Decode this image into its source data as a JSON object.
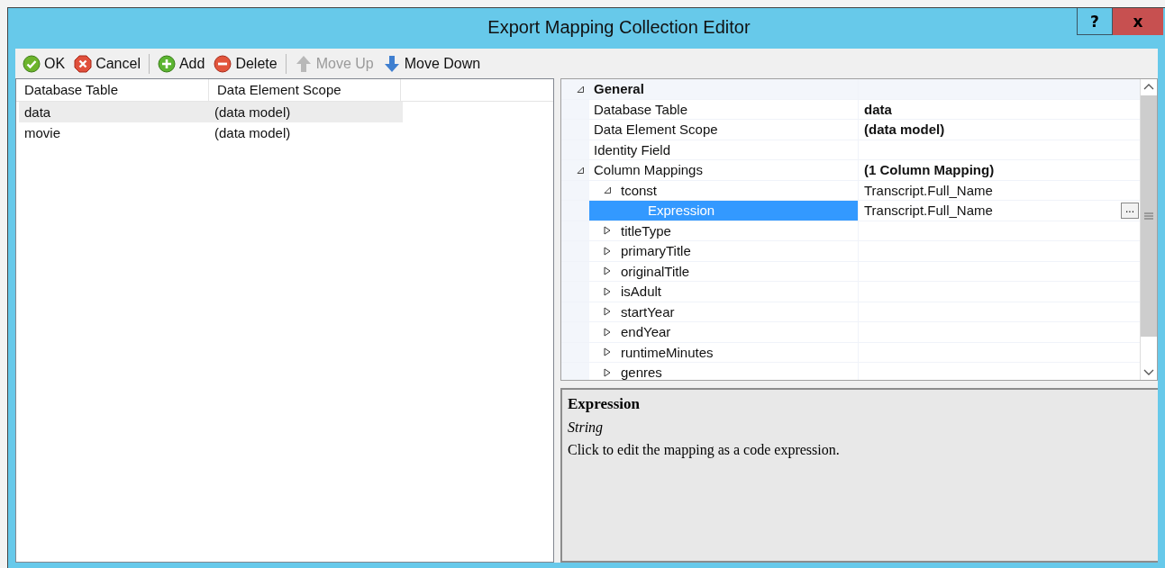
{
  "window": {
    "title": "Export Mapping Collection Editor",
    "help_button": "?",
    "close_button": "x"
  },
  "toolbar": [
    {
      "kind": "ok",
      "label": "OK",
      "disabled": false
    },
    {
      "kind": "cancel",
      "label": "Cancel",
      "disabled": false
    },
    {
      "kind": "separator"
    },
    {
      "kind": "add",
      "label": "Add",
      "disabled": false
    },
    {
      "kind": "delete",
      "label": "Delete",
      "disabled": false
    },
    {
      "kind": "separator"
    },
    {
      "kind": "up",
      "label": "Move Up",
      "disabled": true
    },
    {
      "kind": "down",
      "label": "Move Down",
      "disabled": false
    }
  ],
  "list": {
    "columns": [
      "Database Table",
      "Data Element Scope"
    ],
    "rows": [
      {
        "cells": [
          "data",
          "(data model)"
        ],
        "selected": true
      },
      {
        "cells": [
          "movie",
          "(data model)"
        ],
        "selected": false
      }
    ]
  },
  "properties": [
    {
      "label": "General",
      "expanded": true,
      "children": [
        {
          "label": "Database Table",
          "value": "data",
          "modified": true,
          "selected": false
        },
        {
          "label": "Data Element Scope",
          "value": "(data model)",
          "modified": true,
          "selected": false
        },
        {
          "label": "Identity Field",
          "selected": false
        },
        {
          "label": "Column Mappings",
          "value": "(1 Column Mapping)",
          "modified": true,
          "expanded": true,
          "selected": false,
          "children": [
            {
              "label": "tconst",
              "value": "Transcript.Full_Name",
              "modified": false,
              "expanded": true,
              "selected": false,
              "children": [
                {
                  "label": "Expression",
                  "value": "Transcript.Full_Name",
                  "modified": false,
                  "selected": true,
                  "edit_button": "..."
                }
              ]
            },
            {
              "label": "titleType",
              "expanded": false,
              "selected": false
            },
            {
              "label": "primaryTitle",
              "expanded": false,
              "selected": false
            },
            {
              "label": "originalTitle",
              "expanded": false,
              "selected": false
            },
            {
              "label": "isAdult",
              "expanded": false,
              "selected": false
            },
            {
              "label": "startYear",
              "expanded": false,
              "selected": false
            },
            {
              "label": "endYear",
              "expanded": false,
              "selected": false
            },
            {
              "label": "runtimeMinutes",
              "expanded": false,
              "selected": false
            },
            {
              "label": "genres",
              "expanded": false,
              "selected": false
            }
          ]
        }
      ]
    }
  ],
  "description": {
    "title": "Expression",
    "type": "String",
    "text": "Click to edit the mapping as a code expression."
  }
}
